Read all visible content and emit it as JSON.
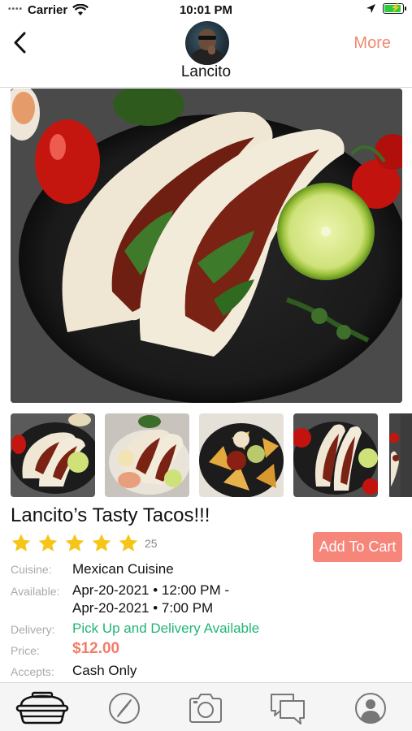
{
  "status_bar": {
    "carrier": "Carrier",
    "time": "10:01 PM"
  },
  "header": {
    "back_icon": "chevron-left-icon",
    "seller_name": "Lancito",
    "more_label": "More",
    "accent_color": "#f08a72"
  },
  "listing": {
    "title": "Lancito’s Tasty Tacos!!!",
    "rating_stars": 5,
    "rating_count": "25",
    "add_to_cart_label": "Add To Cart",
    "details": {
      "cuisine_label": "Cuisine:",
      "cuisine_value": "Mexican Cuisine",
      "available_label": "Available:",
      "available_line1": "Apr-20-2021 • 12:00 PM -",
      "available_line2": "Apr-20-2021 • 7:00 PM",
      "delivery_label": "Delivery:",
      "delivery_value": "Pick Up and Delivery Available",
      "price_label": "Price:",
      "price_value": "$12.00",
      "accepts_label": "Accepts:",
      "accepts_value": "Cash Only"
    }
  },
  "tabbar": {
    "items": [
      "food-container-icon",
      "compass-icon",
      "camera-icon",
      "chat-bubbles-icon",
      "profile-icon"
    ]
  }
}
